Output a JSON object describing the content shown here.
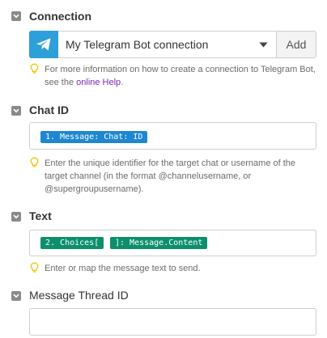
{
  "connection": {
    "label": "Connection",
    "selected": "My Telegram Bot connection",
    "add_label": "Add",
    "hint_text": "For more information on how to create a connection to Telegram Bot, see the ",
    "hint_link": "online Help",
    "hint_end": "."
  },
  "chat_id": {
    "label": "Chat ID",
    "token": "1. Message: Chat: ID",
    "hint": "Enter the unique identifier for the target chat or username of the target channel (in the format @channelusername, or @supergroupusername)."
  },
  "text": {
    "label": "Text",
    "token_a": "2. Choices[",
    "token_b": "]: Message.Content",
    "hint": "Enter or map the message text to send."
  },
  "message_thread": {
    "label": "Message Thread ID",
    "value": ""
  },
  "colors": {
    "telegram_blue": "#2d9fd9",
    "pill_blue": "#1f87d1",
    "pill_green": "#0d8f6c",
    "link_purple": "#7a28b8",
    "bulb_yellow": "#f2c200"
  },
  "icons": {
    "checkbox": "chevron-down-icon",
    "app": "telegram-paper-plane-icon",
    "dropdown": "caret-down-icon",
    "hint": "lightbulb-icon"
  }
}
